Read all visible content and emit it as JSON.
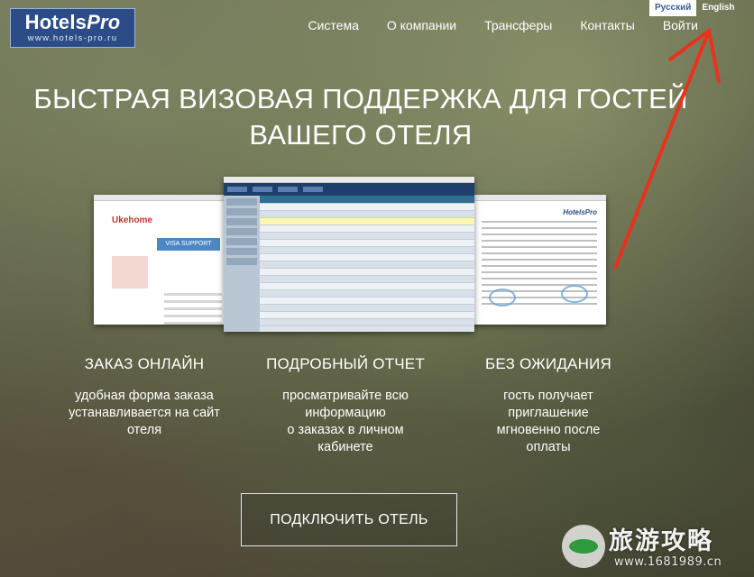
{
  "logo": {
    "name_main": "Hotels",
    "name_accent": "Pro",
    "url": "www.hotels-pro.ru"
  },
  "languages": [
    {
      "label": "Русский",
      "active": true
    },
    {
      "label": "English",
      "active": false
    }
  ],
  "nav": {
    "items": [
      "Система",
      "О компании",
      "Трансферы",
      "Контакты",
      "Войти"
    ]
  },
  "hero": {
    "headline_line1": "БЫСТРАЯ ВИЗОВАЯ ПОДДЕРЖКА ДЛЯ ГОСТЕЙ",
    "headline_line2": "ВАШЕГО ОТЕЛЯ"
  },
  "screenshots": {
    "left_logo": "Ukehome",
    "left_banner": "VISA SUPPORT",
    "right_logo": "HotelsPro"
  },
  "features": [
    {
      "title": "ЗАКАЗ ОНЛАЙН",
      "desc": [
        "удобная форма заказа",
        "устанавливается на сайт",
        "отеля"
      ]
    },
    {
      "title": "ПОДРОБНЫЙ ОТЧЕТ",
      "desc": [
        "просматривайте всю",
        "информацию",
        "о заказах в личном",
        "кабинете"
      ]
    },
    {
      "title": "БЕЗ ОЖИДАНИЯ",
      "desc": [
        "гость получает",
        "приглашение",
        "мгновенно после",
        "оплаты"
      ]
    }
  ],
  "cta": {
    "label": "ПОДКЛЮЧИТЬ ОТЕЛЬ"
  },
  "watermark": {
    "text": "旅游攻略",
    "url": "www.1681989.cn"
  },
  "colors": {
    "logo_bg": "#2b4c86",
    "arrow": "#e8321c",
    "lang_active_text": "#3a5d9c"
  }
}
